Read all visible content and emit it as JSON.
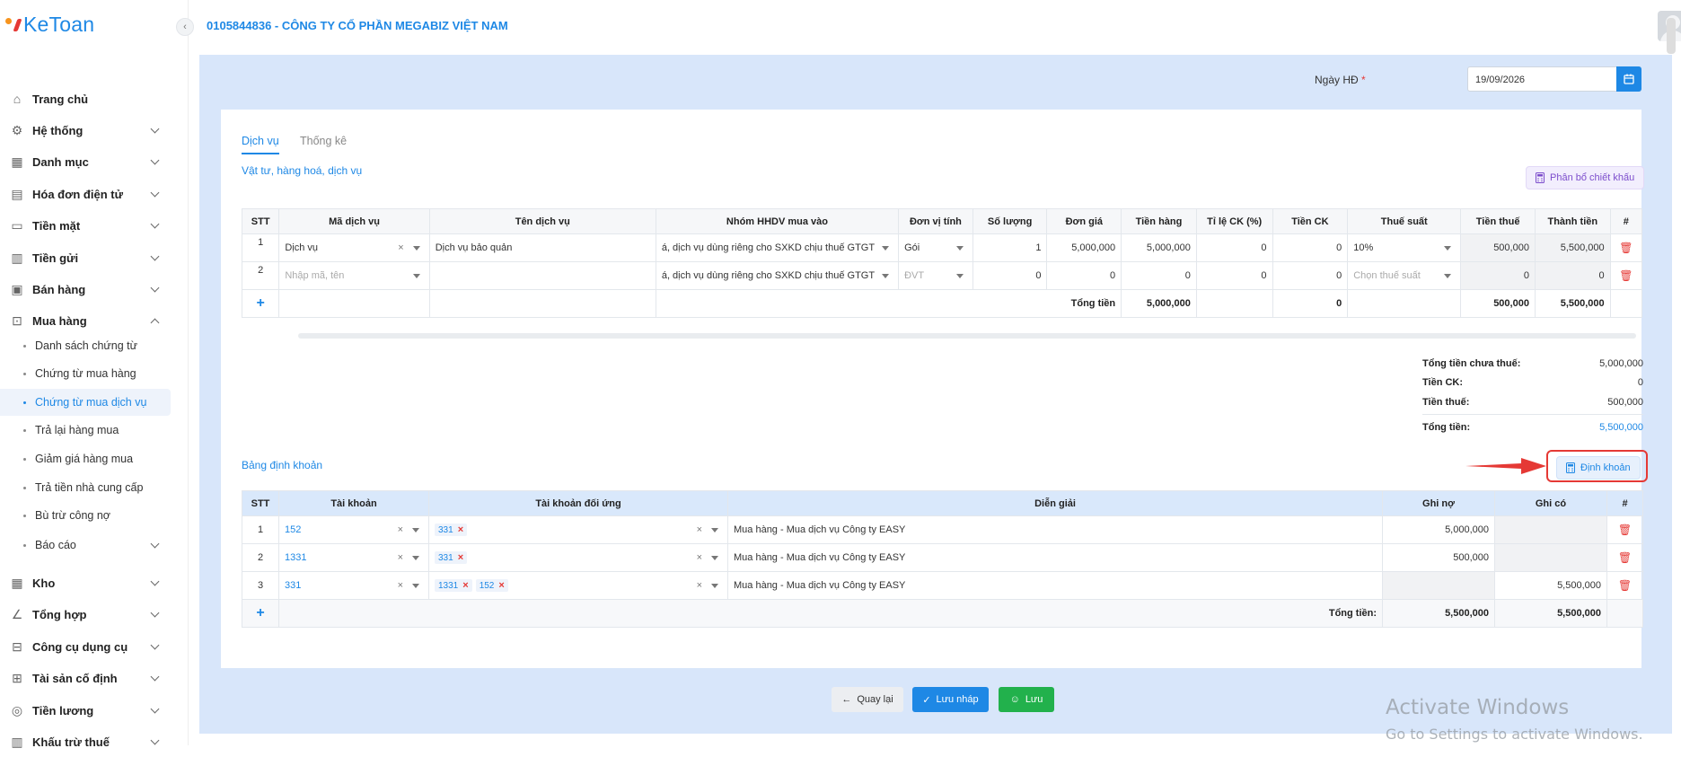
{
  "app": {
    "logo_text": "KeToan"
  },
  "header": {
    "company": "0105844836 - CÔNG TY CỔ PHẦN MEGABIZ VIỆT NAM"
  },
  "sidebar": {
    "items": [
      {
        "label": "Trang chủ",
        "icon": "home-icon"
      },
      {
        "label": "Hệ thống",
        "icon": "gear-icon"
      },
      {
        "label": "Danh mục",
        "icon": "grid-icon"
      },
      {
        "label": "Hóa đơn điện tử",
        "icon": "invoice-icon"
      },
      {
        "label": "Tiền mặt",
        "icon": "cash-icon"
      },
      {
        "label": "Tiền gửi",
        "icon": "bank-icon"
      },
      {
        "label": "Bán hàng",
        "icon": "sell-icon"
      },
      {
        "label": "Mua hàng",
        "icon": "purchase-icon"
      },
      {
        "label": "Kho",
        "icon": "warehouse-icon"
      },
      {
        "label": "Tổng hợp",
        "icon": "chart-icon"
      },
      {
        "label": "Công cụ dụng cụ",
        "icon": "tool-icon"
      },
      {
        "label": "Tài sản cố định",
        "icon": "asset-icon"
      },
      {
        "label": "Tiền lương",
        "icon": "salary-icon"
      },
      {
        "label": "Khấu trừ thuế",
        "icon": "tax-icon"
      }
    ],
    "sub_items": [
      {
        "label": "Danh sách chứng từ"
      },
      {
        "label": "Chứng từ mua hàng"
      },
      {
        "label": "Chứng từ mua dịch vụ"
      },
      {
        "label": "Trả lại hàng mua"
      },
      {
        "label": "Giảm giá hàng mua"
      },
      {
        "label": "Trả tiền nhà cung cấp"
      },
      {
        "label": "Bù trừ công nợ"
      },
      {
        "label": "Báo cáo"
      }
    ]
  },
  "form": {
    "date_label": "Ngày HĐ",
    "required_mark": "*",
    "date_value": "19/09/2026"
  },
  "tabs": [
    {
      "label": "Dịch vụ"
    },
    {
      "label": "Thống kê"
    }
  ],
  "services": {
    "section_title": "Vật tư, hàng hoá, dịch vụ",
    "discount_button": "Phân bổ chiết khấu",
    "columns": [
      "STT",
      "Mã dịch vụ",
      "Tên dịch vụ",
      "Nhóm HHDV mua vào",
      "Đơn vị tính",
      "Số lượng",
      "Đơn giá",
      "Tiền hàng",
      "Tỉ lệ CK (%)",
      "Tiền CK",
      "Thuế suất",
      "Tiền thuế",
      "Thành tiền",
      "#"
    ],
    "rows": [
      {
        "stt": "1",
        "code": "Dịch vụ",
        "code_clear": "×",
        "name": "Dịch vụ bảo quản",
        "group": "á, dịch vụ dùng riêng cho SXKD chịu thuế GTGT",
        "unit": "Gói",
        "qty": "1",
        "price": "5,000,000",
        "amount": "5,000,000",
        "ck_rate": "0",
        "ck": "0",
        "tax_rate": "10%",
        "tax": "500,000",
        "total": "5,500,000"
      },
      {
        "stt": "2",
        "code_placeholder": "Nhập mã, tên",
        "name": "",
        "group": "á, dịch vụ dùng riêng cho SXKD chịu thuế GTGT",
        "unit_placeholder": "ĐVT",
        "qty": "0",
        "price": "0",
        "amount": "0",
        "ck_rate": "0",
        "ck": "0",
        "tax_placeholder": "Chọn thuế suất",
        "tax": "0",
        "total": "0"
      }
    ],
    "total_label": "Tổng tiền",
    "total_amount": "5,000,000",
    "total_ck": "0",
    "total_tax": "500,000",
    "total_total": "5,500,000"
  },
  "summary": {
    "pretax_label": "Tổng tiền chưa thuế:",
    "pretax_value": "5,000,000",
    "ck_label": "Tiền CK:",
    "ck_value": "0",
    "tax_label": "Tiền thuế:",
    "tax_value": "500,000",
    "total_label": "Tổng tiền:",
    "total_value": "5,500,000"
  },
  "entries": {
    "section_title": "Bảng định khoản",
    "button_label": "Định khoản",
    "columns": [
      "STT",
      "Tài khoản",
      "Tài khoản đối ứng",
      "Diễn giải",
      "Ghi nợ",
      "Ghi có",
      "#"
    ],
    "rows": [
      {
        "stt": "1",
        "account": "152",
        "contra": [
          "331"
        ],
        "desc": "Mua hàng - Mua dịch vụ Công ty EASY",
        "debit": "5,000,000",
        "credit": ""
      },
      {
        "stt": "2",
        "account": "1331",
        "contra": [
          "331"
        ],
        "desc": "Mua hàng - Mua dịch vụ Công ty EASY",
        "debit": "500,000",
        "credit": ""
      },
      {
        "stt": "3",
        "account": "331",
        "contra": [
          "1331",
          "152"
        ],
        "desc": "Mua hàng - Mua dịch vụ Công ty EASY",
        "debit": "",
        "credit": "5,500,000"
      }
    ],
    "total_label": "Tổng tiền:",
    "total_debit": "5,500,000",
    "total_credit": "5,500,000"
  },
  "footer": {
    "back": "Quay lại",
    "draft": "Lưu nháp",
    "save": "Lưu"
  },
  "watermark": {
    "line1": "Activate Windows",
    "line2": "Go to Settings to activate Windows."
  },
  "colors": {
    "accent": "#1e88e5",
    "danger": "#e53935",
    "save": "#22b14c",
    "bg": "#d8e6fa"
  }
}
